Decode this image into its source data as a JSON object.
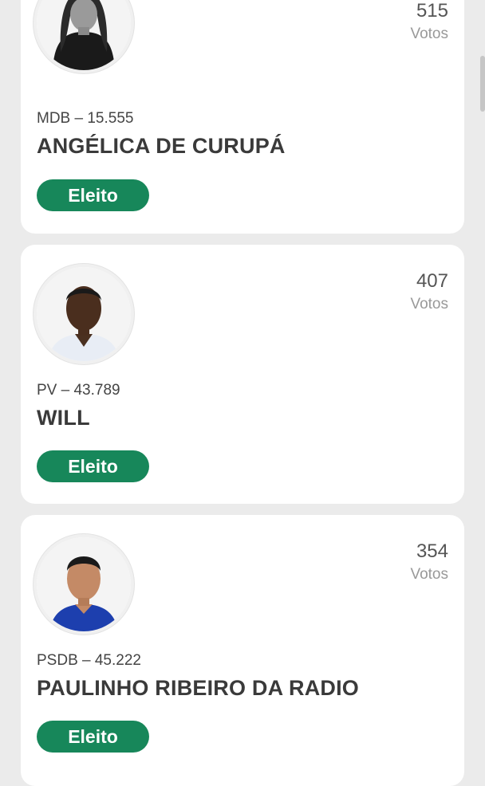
{
  "candidates": [
    {
      "votes": "515",
      "votes_label": "Votos",
      "party": "MDB – 15.555",
      "name": "ANGÉLICA DE CURUPÁ",
      "status": "Eleito"
    },
    {
      "votes": "407",
      "votes_label": "Votos",
      "party": "PV – 43.789",
      "name": "WILL",
      "status": "Eleito"
    },
    {
      "votes": "354",
      "votes_label": "Votos",
      "party": "PSDB – 45.222",
      "name": "PAULINHO RIBEIRO DA RADIO",
      "status": "Eleito"
    }
  ],
  "colors": {
    "status_badge": "#17875a",
    "card": "#ffffff",
    "background": "#ebebeb"
  }
}
